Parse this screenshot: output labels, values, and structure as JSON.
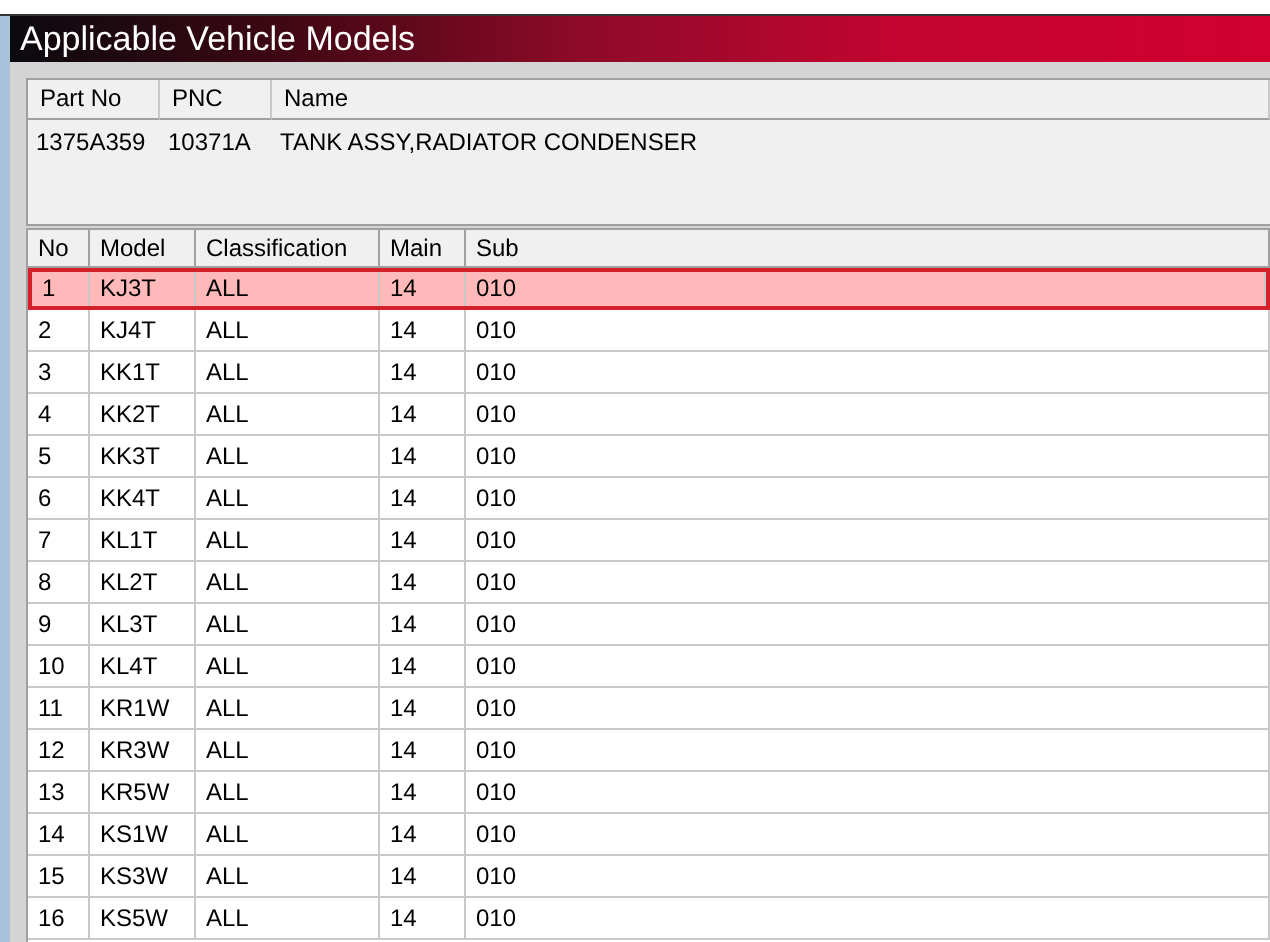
{
  "window": {
    "title": "Applicable Vehicle Models"
  },
  "part": {
    "columns": [
      "Part No",
      "PNC",
      "Name"
    ],
    "row": [
      "1375A359",
      "10371A",
      "TANK ASSY,RADIATOR CONDENSER"
    ]
  },
  "table": {
    "columns": [
      "No",
      "Model",
      "Classification",
      "Main",
      "Sub"
    ],
    "rows": [
      {
        "cells": [
          "1",
          "KJ3T",
          "ALL",
          "14",
          "010"
        ],
        "selected": true
      },
      {
        "cells": [
          "2",
          "KJ4T",
          "ALL",
          "14",
          "010"
        ],
        "selected": false
      },
      {
        "cells": [
          "3",
          "KK1T",
          "ALL",
          "14",
          "010"
        ],
        "selected": false
      },
      {
        "cells": [
          "4",
          "KK2T",
          "ALL",
          "14",
          "010"
        ],
        "selected": false
      },
      {
        "cells": [
          "5",
          "KK3T",
          "ALL",
          "14",
          "010"
        ],
        "selected": false
      },
      {
        "cells": [
          "6",
          "KK4T",
          "ALL",
          "14",
          "010"
        ],
        "selected": false
      },
      {
        "cells": [
          "7",
          "KL1T",
          "ALL",
          "14",
          "010"
        ],
        "selected": false
      },
      {
        "cells": [
          "8",
          "KL2T",
          "ALL",
          "14",
          "010"
        ],
        "selected": false
      },
      {
        "cells": [
          "9",
          "KL3T",
          "ALL",
          "14",
          "010"
        ],
        "selected": false
      },
      {
        "cells": [
          "10",
          "KL4T",
          "ALL",
          "14",
          "010"
        ],
        "selected": false
      },
      {
        "cells": [
          "11",
          "KR1W",
          "ALL",
          "14",
          "010"
        ],
        "selected": false
      },
      {
        "cells": [
          "12",
          "KR3W",
          "ALL",
          "14",
          "010"
        ],
        "selected": false
      },
      {
        "cells": [
          "13",
          "KR5W",
          "ALL",
          "14",
          "010"
        ],
        "selected": false
      },
      {
        "cells": [
          "14",
          "KS1W",
          "ALL",
          "14",
          "010"
        ],
        "selected": false
      },
      {
        "cells": [
          "15",
          "KS3W",
          "ALL",
          "14",
          "010"
        ],
        "selected": false
      },
      {
        "cells": [
          "16",
          "KS5W",
          "ALL",
          "14",
          "010"
        ],
        "selected": false
      }
    ]
  }
}
